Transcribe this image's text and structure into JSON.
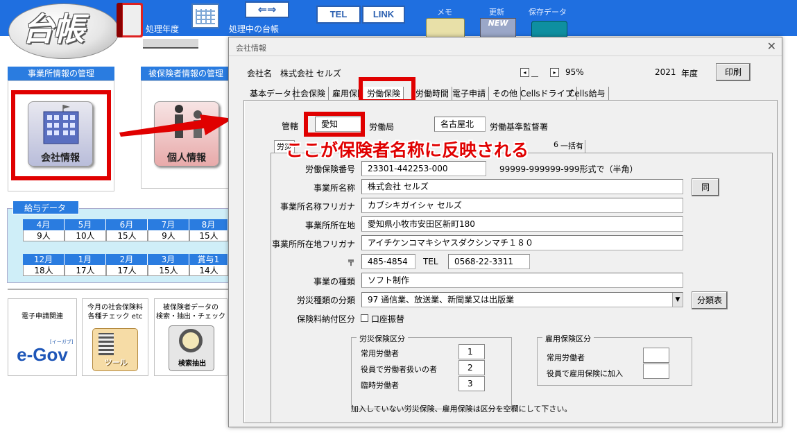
{
  "app": {
    "logo_text": "台帳",
    "fiscal_year_label": "処理年度",
    "current_ledger_label": "処理中の台帳",
    "tel_button": "TEL",
    "link_button": "LINK",
    "memo_label": "メモ",
    "update_label": "更新",
    "save_label": "保存データ",
    "update_badge": "NEW"
  },
  "left": {
    "office_section": "事業所情報の管理",
    "insured_section": "被保険者情報の管理",
    "company_info": "会社情報",
    "personal_info": "個人情報",
    "salary_tab": "給与データ",
    "salary_row1_months": [
      "4月",
      "5月",
      "6月",
      "7月",
      "8月"
    ],
    "salary_row1_counts": [
      "9人",
      "10人",
      "15人",
      "9人",
      "15人"
    ],
    "salary_row2_months": [
      "12月",
      "1月",
      "2月",
      "3月",
      "賞与1"
    ],
    "salary_row2_counts": [
      "18人",
      "17人",
      "17人",
      "15人",
      "14人"
    ],
    "panel_egov_title": "電子申請関連",
    "egov_logo": "e-Gov",
    "egov_small": "[イーガブ]",
    "panel_check_title": "今月の社会保険料\n各種チェック etc",
    "tool_label": "ツール",
    "panel_search_title": "被保険者データの\n検索・抽出・チェック",
    "search_label": "検索抽出"
  },
  "dialog": {
    "title": "会社情報",
    "company_label": "会社名",
    "company_name": "株式会社 セルズ",
    "zoom": "95%",
    "year": "2021",
    "year_suffix": "年度",
    "print_button": "印刷",
    "tabs": [
      "基本データ",
      "社会保険",
      "雇用保険",
      "労働保険",
      "労働時間",
      "電子申請",
      "その他",
      "Cellsドライブ",
      "Cells給与"
    ],
    "jurisdiction_label": "管轄",
    "jurisdiction_value": "愛知",
    "labor_bureau_suffix": "労働局",
    "inspection_office_value": "名古屋北",
    "inspection_office_suffix": "労働基準監督署",
    "subtab_left": "労災",
    "subtab_right": "一括有期",
    "subtab_mid": "6",
    "insurance_number_label": "労働保険番号",
    "insurance_number": "23301-442253-000",
    "insurance_number_hint": "99999-999999-999形式で（半角）",
    "office_name_label": "事業所名称",
    "office_name": "株式会社 セルズ",
    "same_button": "同",
    "office_kana_label": "事業所名称フリガナ",
    "office_kana": "カブシキガイシャ セルズ",
    "address_label": "事業所所在地",
    "address": "愛知県小牧市安田区新町180",
    "address_kana_label": "事業所所在地フリガナ",
    "address_kana": "アイチケンコマキシヤスダクシンマチ１８０",
    "postal_label": "〒",
    "postal": "485-4854",
    "tel_label": "TEL",
    "tel": "0568-22-3311",
    "business_type_label": "事業の種類",
    "business_type": "ソフト制作",
    "accident_class_label": "労災種類の分類",
    "accident_class": "97 通信業、放送業、新聞業又は出版業",
    "class_table_button": "分類表",
    "payment_label": "保険料納付区分",
    "payment_checkbox": "口座振替",
    "accident_group_title": "労災保険区分",
    "regular_workers_label": "常用労働者",
    "regular_workers_value": "1",
    "executive_workers_label": "役員で労働者扱いの者",
    "executive_workers_value": "2",
    "temp_workers_label": "臨時労働者",
    "temp_workers_value": "3",
    "employment_group_title": "雇用保険区分",
    "emp_regular_label": "常用労働者",
    "emp_regular_value": "",
    "emp_exec_label": "役員で雇用保険に加入",
    "emp_exec_value": "",
    "footer_note": "加入していない労災保険、雇用保険は区分を空欄にして下さい。"
  },
  "annotation": {
    "text": "ここが保険者名称に反映される",
    "color": "#e00000"
  },
  "colors": {
    "banner": "#1f6fe0",
    "section_header": "#2a7ce0",
    "highlight": "#e00000"
  }
}
